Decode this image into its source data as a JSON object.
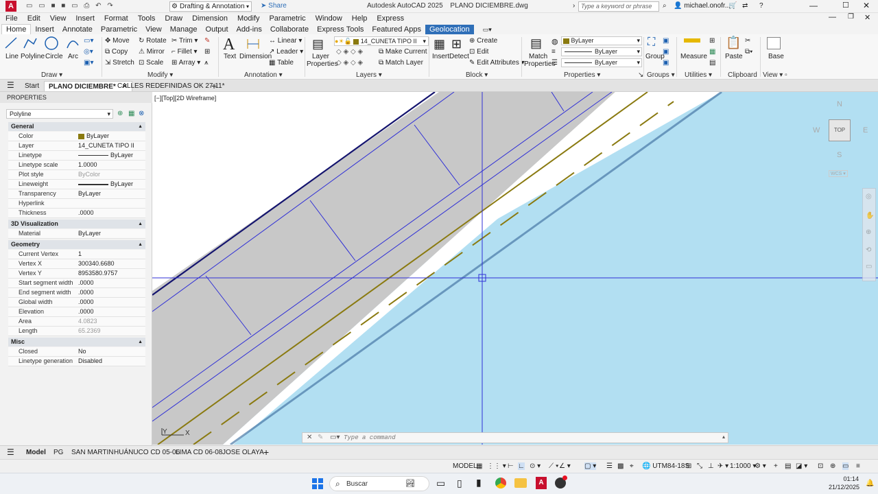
{
  "titlebar": {
    "app_letter": "A",
    "workspace": "Drafting & Annotation",
    "share": "Share",
    "title": "Autodesk AutoCAD 2025",
    "filename": "PLANO DICIEMBRE.dwg",
    "search_placeholder": "Type a keyword or phrase",
    "user": "michael.onofr..."
  },
  "menu": [
    "File",
    "Edit",
    "View",
    "Insert",
    "Format",
    "Tools",
    "Draw",
    "Dimension",
    "Modify",
    "Parametric",
    "Window",
    "Help",
    "Express"
  ],
  "ribbon_tabs": [
    "Home",
    "Insert",
    "Annotate",
    "Parametric",
    "View",
    "Manage",
    "Output",
    "Add-ins",
    "Collaborate",
    "Express Tools",
    "Featured Apps",
    "Geolocation"
  ],
  "ribbon": {
    "draw": {
      "line": "Line",
      "polyline": "Polyline",
      "circle": "Circle",
      "arc": "Arc",
      "label": "Draw"
    },
    "modify": {
      "move": "Move",
      "rotate": "Rotate",
      "trim": "Trim",
      "copy": "Copy",
      "mirror": "Mirror",
      "fillet": "Fillet",
      "stretch": "Stretch",
      "scale": "Scale",
      "array": "Array",
      "label": "Modify"
    },
    "annotation": {
      "text": "Text",
      "dimension": "Dimension",
      "linear": "Linear",
      "leader": "Leader",
      "table": "Table",
      "label": "Annotation"
    },
    "layers": {
      "layer_properties_1": "Layer",
      "layer_properties_2": "Properties",
      "current_layer": "14_CUNETA TIPO II",
      "make_current": "Make Current",
      "match_layer": "Match Layer",
      "label": "Layers"
    },
    "block": {
      "insert": "Insert",
      "detect": "Detect",
      "create": "Create",
      "edit": "Edit",
      "edit_attributes": "Edit Attributes",
      "label": "Block"
    },
    "properties": {
      "match_1": "Match",
      "match_2": "Properties",
      "color": "ByLayer",
      "linetype": "ByLayer",
      "lineweight": "ByLayer",
      "label": "Properties"
    },
    "groups": {
      "group": "Group",
      "label": "Groups"
    },
    "utilities": {
      "measure": "Measure",
      "label": "Utilities"
    },
    "clipboard": {
      "paste": "Paste",
      "label": "Clipboard"
    },
    "view": {
      "base": "Base",
      "label": "View"
    }
  },
  "doc_tabs": {
    "start": "Start",
    "active": "PLANO DICIEMBRE*",
    "other": "CALLES REDEFINIDAS OK 27.11*"
  },
  "properties_panel": {
    "title": "PROPERTIES",
    "object": "Polyline",
    "sections": {
      "general": "General",
      "viz": "3D Visualization",
      "geometry": "Geometry",
      "misc": "Misc"
    },
    "general": [
      {
        "k": "Color",
        "v": "ByLayer"
      },
      {
        "k": "Layer",
        "v": "14_CUNETA TIPO II"
      },
      {
        "k": "Linetype",
        "v": "ByLayer"
      },
      {
        "k": "Linetype scale",
        "v": "1.0000"
      },
      {
        "k": "Plot style",
        "v": "ByColor"
      },
      {
        "k": "Lineweight",
        "v": "ByLayer"
      },
      {
        "k": "Transparency",
        "v": "ByLayer"
      },
      {
        "k": "Hyperlink",
        "v": ""
      },
      {
        "k": "Thickness",
        "v": ".0000"
      }
    ],
    "viz": [
      {
        "k": "Material",
        "v": "ByLayer"
      }
    ],
    "geometry": [
      {
        "k": "Current Vertex",
        "v": "1"
      },
      {
        "k": "Vertex X",
        "v": "300340.6680"
      },
      {
        "k": "Vertex Y",
        "v": "8953580.9757"
      },
      {
        "k": "Start segment width",
        "v": ".0000"
      },
      {
        "k": "End segment width",
        "v": ".0000"
      },
      {
        "k": "Global width",
        "v": ".0000"
      },
      {
        "k": "Elevation",
        "v": ".0000"
      },
      {
        "k": "Area",
        "v": "4.0823"
      },
      {
        "k": "Length",
        "v": "65.2369"
      }
    ],
    "misc": [
      {
        "k": "Closed",
        "v": "No"
      },
      {
        "k": "Linetype generation",
        "v": "Disabled"
      }
    ]
  },
  "viewport": {
    "label": "[−][Top][2D Wireframe]",
    "viewcube": {
      "n": "N",
      "s": "S",
      "e": "E",
      "w": "W",
      "face": "TOP",
      "wcs": "WCS"
    },
    "command_placeholder": "Type a command",
    "ucs_y": "Y",
    "ucs_x": "X"
  },
  "layout_tabs": [
    "Model",
    "PG",
    "SAN MARTIN",
    "HUÁNUCO CD 05-06",
    "LIMA CD 06-08",
    "JOSE OLAYA"
  ],
  "statusbar": {
    "model": "MODEL",
    "coord": "UTM84-18S",
    "scale": "1:1000"
  },
  "taskbar": {
    "search": "Buscar",
    "time": "01:14",
    "date": "21/12/2025"
  },
  "colors": {
    "ribbon_tab_geo": "#2f6fb8",
    "canvas_water": "#b2dff2",
    "road_gray": "#c8c8c8",
    "polyline_blue": "#2f2fd6",
    "centerline": "#8a7a10"
  }
}
